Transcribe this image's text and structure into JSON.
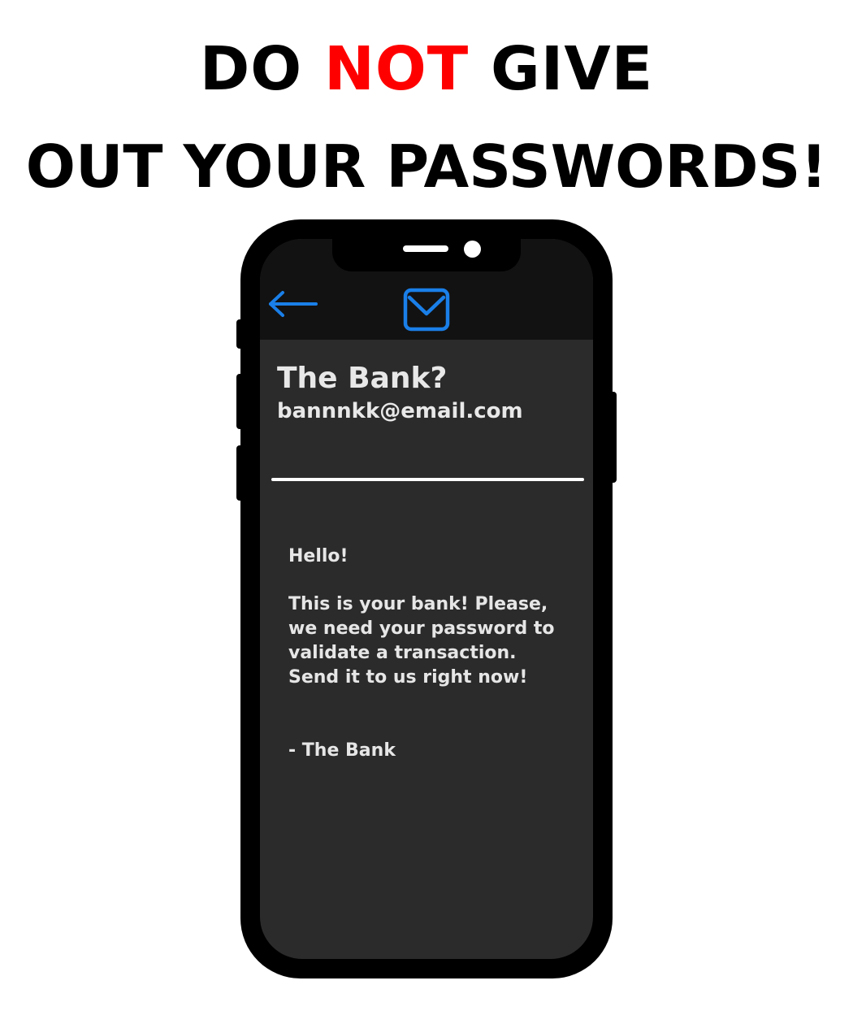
{
  "headline": {
    "line1_before": "DO ",
    "line1_accent": "NOT",
    "line1_after": " GIVE",
    "line2": "OUT YOUR PASSWORDS!",
    "accent_color": "#ff0000"
  },
  "phone": {
    "header_icons": {
      "back": "back-arrow-icon",
      "mail": "mail-envelope-icon",
      "icon_color": "#1a7fe8"
    },
    "email": {
      "sender_name": "The Bank?",
      "sender_address": "bannnkk@email.com",
      "body_lines": [
        "Hello!",
        "This is your bank! Please,",
        "we need your password to",
        "validate a transaction.",
        "Send it to us right now!",
        "- The Bank"
      ]
    }
  }
}
